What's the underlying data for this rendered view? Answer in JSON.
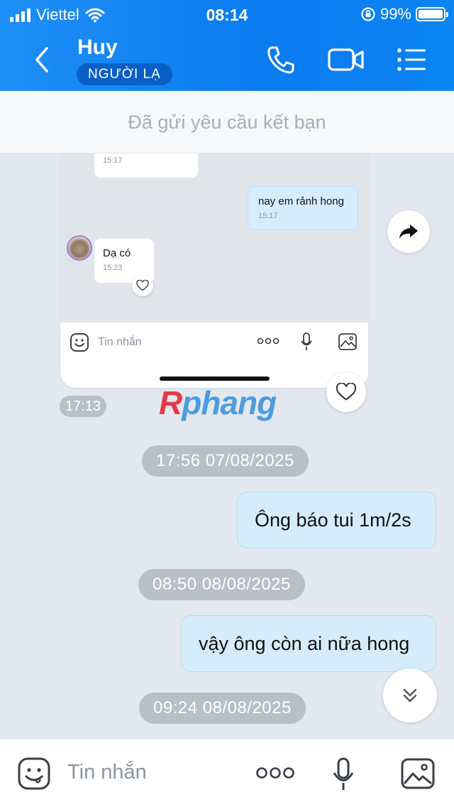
{
  "status": {
    "carrier": "Viettel",
    "time": "08:14",
    "battery": "99%",
    "battery_level": 0.99
  },
  "header": {
    "contact_name": "Huy",
    "badge": "NGƯỜI LẠ",
    "icons": [
      "back-icon",
      "phone-icon",
      "video-icon",
      "menu-icon"
    ]
  },
  "friend_request": {
    "text": "Đã gửi yêu cầu kết bạn"
  },
  "embedded_screenshot": {
    "cut_message_time": "15:17",
    "outgoing": {
      "text": "nay em rảnh hong",
      "time": "15:17"
    },
    "incoming": {
      "text": "Dạ có",
      "time": "15:23"
    },
    "input_placeholder": "Tin nhắn",
    "sent_time": "17:13"
  },
  "watermark": {
    "first": "R",
    "rest": "phang"
  },
  "conversation": [
    {
      "type": "timestamp",
      "text": "17:56 07/08/2025"
    },
    {
      "type": "outgoing",
      "text": "Ông báo tui 1m/2s"
    },
    {
      "type": "timestamp",
      "text": "08:50 08/08/2025"
    },
    {
      "type": "outgoing",
      "text": "vậy ông còn ai nữa hong"
    },
    {
      "type": "timestamp",
      "text": "09:24 08/08/2025"
    }
  ],
  "input": {
    "placeholder": "Tin nhắn",
    "icons": [
      "emoji-icon",
      "more-icon",
      "mic-icon",
      "image-icon"
    ]
  },
  "colors": {
    "header_blue": "#0a7bf0",
    "outgoing_bubble": "#d5ecfb",
    "timestamp_pill": "#b9bfc6",
    "background": "#e2e8ef"
  }
}
